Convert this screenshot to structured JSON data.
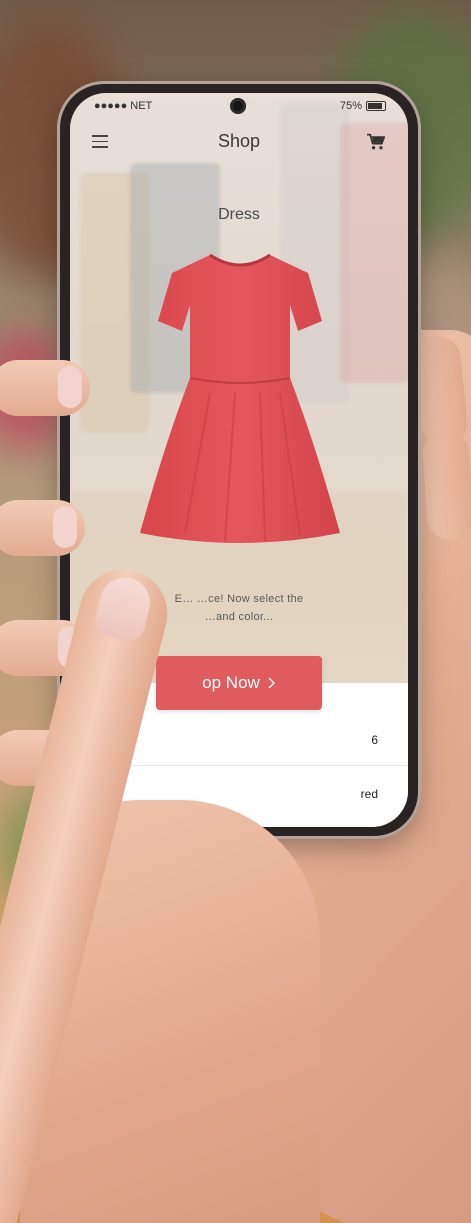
{
  "status_bar": {
    "carrier": "●●●●● NET",
    "battery": "75%"
  },
  "nav": {
    "title": "Shop",
    "menu_icon": "hamburger-menu-icon",
    "cart_icon": "shopping-cart-icon"
  },
  "product": {
    "name": "Dress",
    "color_hex": "#e0565a",
    "instruction_line1": "E… …ce! Now select the",
    "instruction_line2": "…and color..."
  },
  "cta": {
    "label": "op Now",
    "icon": "chevron-right-icon",
    "color": "#e05b5e"
  },
  "options": [
    {
      "value": "6"
    },
    {
      "value": "red"
    }
  ]
}
